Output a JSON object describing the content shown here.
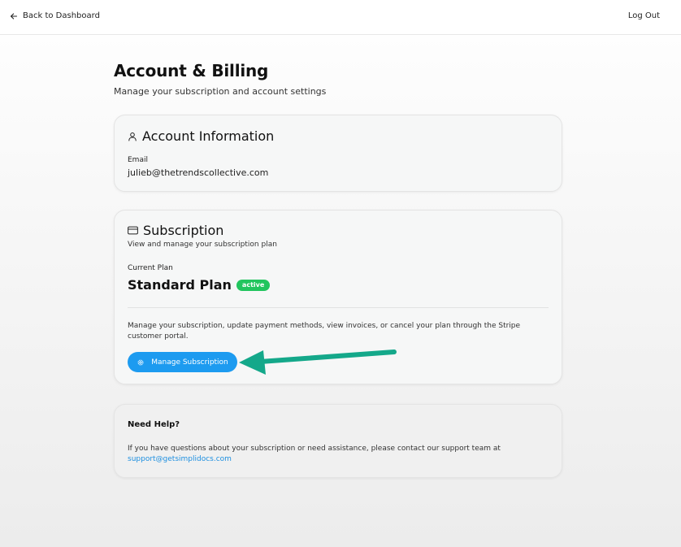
{
  "header": {
    "back_label": "Back to Dashboard",
    "logout_label": "Log Out",
    "back_icon": "arrow-left-icon"
  },
  "page": {
    "title": "Account & Billing",
    "subtitle": "Manage your subscription and account settings"
  },
  "account": {
    "icon": "user-icon",
    "heading": "Account Information",
    "email_label": "Email",
    "email_value": "julieb@thetrendscollective.com"
  },
  "subscription": {
    "icon": "credit-card-icon",
    "heading": "Subscription",
    "description": "View and manage your subscription plan",
    "current_plan_label": "Current Plan",
    "plan_name": "Standard Plan",
    "status": "active",
    "manage_description": "Manage your subscription, update payment methods, view invoices, or cancel your plan through the Stripe customer portal.",
    "button_label": "Manage Subscription",
    "button_icon": "gear-icon"
  },
  "help": {
    "heading": "Need Help?",
    "text": "If you have questions about your subscription or need assistance, please contact our support team at",
    "email": "support@getsimplidocs.com"
  },
  "colors": {
    "accent": "#1d9bf0",
    "status_active": "#22c55e",
    "annotation_arrow": "#14a88a",
    "link": "#1d8fe0"
  }
}
